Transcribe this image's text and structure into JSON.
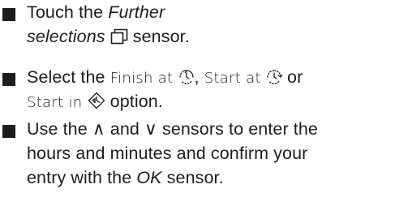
{
  "steps": [
    {
      "pre": "Touch the ",
      "em": "Further",
      "em2": "selections",
      "post": " sensor.",
      "icon": "further-selections-icon"
    },
    {
      "pre": "Select the ",
      "opt1": "Finish at",
      "mid1": ", ",
      "opt2": "Start at",
      "mid2": " or",
      "opt3": "Start in",
      "post": " option.",
      "icons": [
        "finish-at-icon",
        "start-at-icon",
        "start-in-icon"
      ]
    },
    {
      "line1_pre": "Use the ",
      "up": "∧",
      "and": " and ",
      "down": "∨",
      "line1_post": " sensors to enter the",
      "line2": "hours and minutes and confirm your",
      "line3_pre": "entry with the ",
      "ok": "OK",
      "line3_post": " sensor."
    }
  ]
}
